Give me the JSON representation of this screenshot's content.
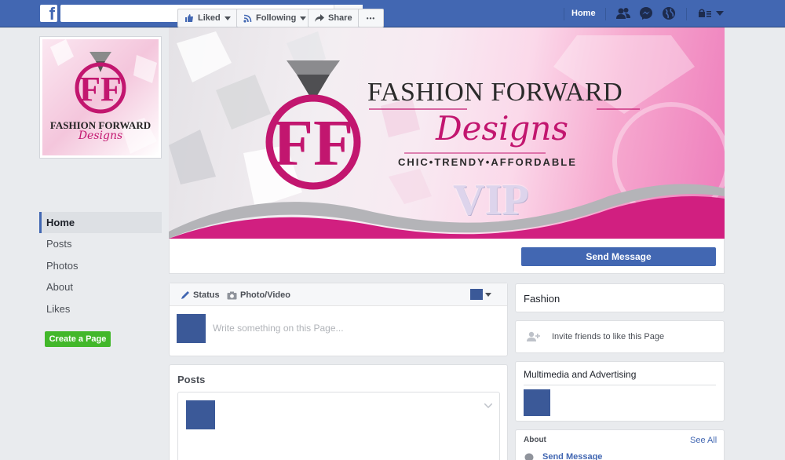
{
  "topbar": {
    "logo": "f",
    "search_placeholder": "",
    "home_label": "Home",
    "icons": [
      "search-icon",
      "friends-icon",
      "messenger-icon",
      "globe-icon",
      "privacy-icon",
      "caret-down-icon"
    ]
  },
  "profile": {
    "brand_line1": "FASHION FORWARD",
    "brand_line2": "Designs"
  },
  "nav": {
    "items": [
      {
        "label": "Home",
        "active": true
      },
      {
        "label": "Posts"
      },
      {
        "label": "Photos"
      },
      {
        "label": "About"
      },
      {
        "label": "Likes"
      }
    ],
    "create_page": "Create a Page"
  },
  "cover": {
    "title": "FASHION FORWARD",
    "script": "Designs",
    "tagline": "CHIC•TRENDY•AFFORDABLE",
    "badge": "VIP",
    "colors": {
      "pink": "#c2166f",
      "silver": "#9a9a9a"
    }
  },
  "actions": {
    "liked": "Liked",
    "following": "Following",
    "share": "Share",
    "more": "•••",
    "send_message": "Send Message"
  },
  "composer": {
    "status_tab": "Status",
    "photo_tab": "Photo/Video",
    "placeholder": "Write something on this Page..."
  },
  "posts": {
    "heading": "Posts"
  },
  "right": {
    "category": "Fashion",
    "invite": "Invite friends to like this Page",
    "multimedia": "Multimedia and Advertising",
    "about_heading": "About",
    "see_all": "See All",
    "send_message": "Send Message"
  },
  "colors": {
    "fb_blue": "#4267b2",
    "green": "#42b72a",
    "bg": "#e9ebee"
  }
}
